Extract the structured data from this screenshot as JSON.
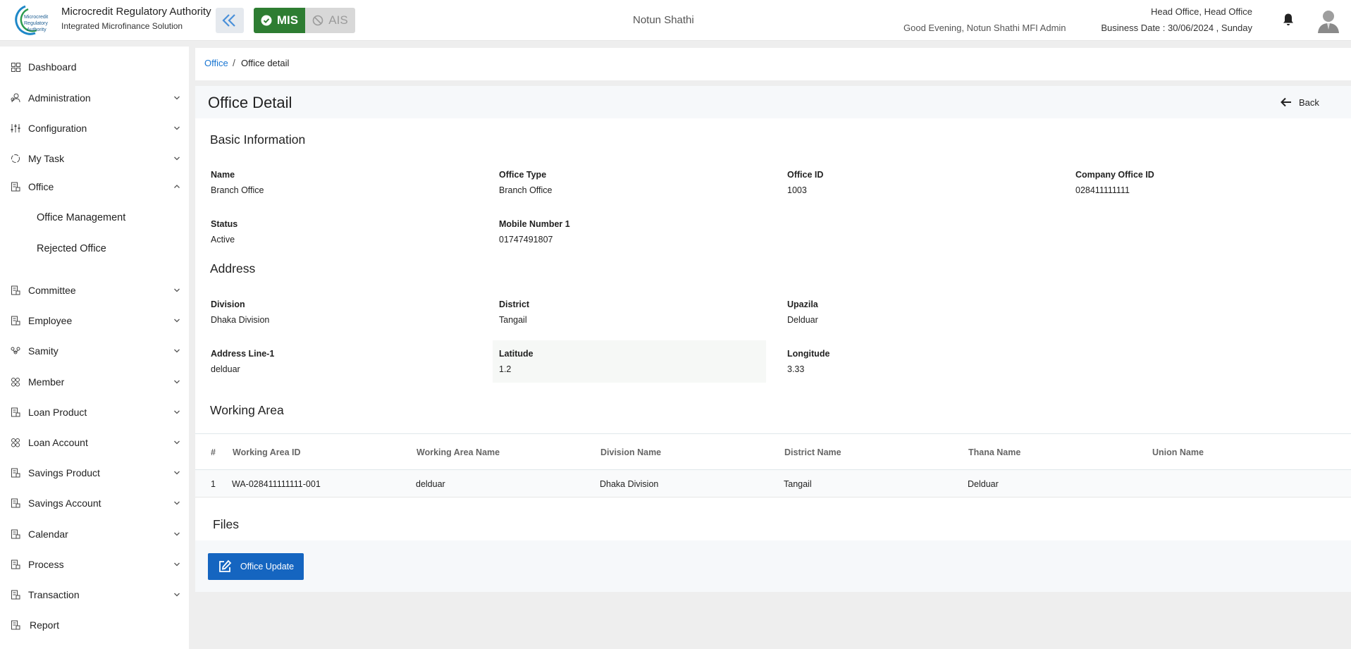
{
  "header": {
    "brand_title": "Microcredit Regulatory Authority",
    "brand_subtitle": "Integrated Microfinance Solution",
    "logo_text": [
      "Microcredit",
      "Regulatory",
      "Authority"
    ],
    "mode_mis": "MIS",
    "mode_ais": "AIS",
    "org_name": "Notun Shathi",
    "greeting": "Good Evening, Notun Shathi MFI Admin",
    "office_line": "Head Office, Head Office",
    "business_date": "Business Date : 30/06/2024 , Sunday"
  },
  "sidebar": {
    "items": [
      {
        "label": "Dashboard",
        "icon": "grid-icon",
        "chevron": false
      },
      {
        "label": "Administration",
        "icon": "users-icon",
        "chevron": true
      },
      {
        "label": "Configuration",
        "icon": "sliders-icon",
        "chevron": true
      },
      {
        "label": "My Task",
        "icon": "refresh-icon",
        "chevron": true
      },
      {
        "label": "Office",
        "icon": "building-icon",
        "chevron": true,
        "expanded": true
      },
      {
        "label": "Committee",
        "icon": "building-icon",
        "chevron": true
      },
      {
        "label": "Employee",
        "icon": "building-icon",
        "chevron": true
      },
      {
        "label": "Samity",
        "icon": "group-icon",
        "chevron": true
      },
      {
        "label": "Member",
        "icon": "members-icon",
        "chevron": true
      },
      {
        "label": "Loan Product",
        "icon": "building-icon",
        "chevron": true
      },
      {
        "label": "Loan Account",
        "icon": "members-icon",
        "chevron": true
      },
      {
        "label": "Savings Product",
        "icon": "building-icon",
        "chevron": true
      },
      {
        "label": "Savings Account",
        "icon": "building-icon",
        "chevron": true
      },
      {
        "label": "Calendar",
        "icon": "building-icon",
        "chevron": true
      },
      {
        "label": "Process",
        "icon": "building-icon",
        "chevron": true
      },
      {
        "label": "Transaction",
        "icon": "building-icon",
        "chevron": true
      },
      {
        "label": "Report",
        "icon": "building-icon",
        "chevron": false
      }
    ],
    "office_sub": [
      "Office Management",
      "Rejected Office"
    ]
  },
  "breadcrumb": {
    "link": "Office",
    "separator": "/",
    "current": "Office detail"
  },
  "page": {
    "title": "Office Detail",
    "back_label": "Back"
  },
  "basic_info": {
    "title": "Basic Information",
    "fields": [
      {
        "label": "Name",
        "value": "Branch Office"
      },
      {
        "label": "Office Type",
        "value": "Branch Office"
      },
      {
        "label": "Office ID",
        "value": "1003"
      },
      {
        "label": "Company Office ID",
        "value": "028411111111"
      },
      {
        "label": "Status",
        "value": "Active"
      },
      {
        "label": "Mobile Number 1",
        "value": "01747491807"
      }
    ]
  },
  "address": {
    "title": "Address",
    "fields": [
      {
        "label": "Division",
        "value": "Dhaka Division"
      },
      {
        "label": "District",
        "value": "Tangail"
      },
      {
        "label": "Upazila",
        "value": "Delduar"
      },
      {
        "label": "Address Line-1",
        "value": "delduar"
      },
      {
        "label": "Latitude",
        "value": "1.2"
      },
      {
        "label": "Longitude",
        "value": "3.33"
      }
    ]
  },
  "working_area": {
    "title": "Working Area",
    "columns": [
      "#",
      "Working Area ID",
      "Working Area Name",
      "Division Name",
      "District Name",
      "Thana Name",
      "Union Name"
    ],
    "rows": [
      [
        "1",
        "WA-028411111111-001",
        "delduar",
        "Dhaka Division",
        "Tangail",
        "Delduar",
        ""
      ]
    ]
  },
  "files": {
    "title": "Files",
    "update_button": "Office Update"
  },
  "colors": {
    "primary": "#1565c0",
    "mis_active": "#2e7d32",
    "link": "#1976d2"
  }
}
